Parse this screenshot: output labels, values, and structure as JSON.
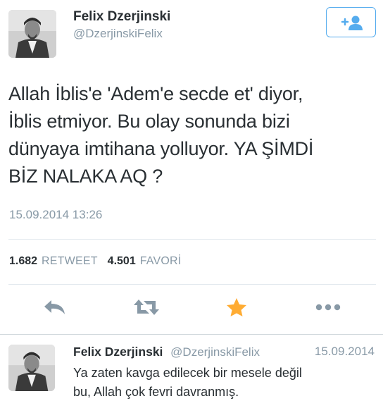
{
  "tweet": {
    "name": "Felix Dzerjinski",
    "handle": "@DzerjinskiFelix",
    "text_lines": [
      "Allah İblis'e 'Adem'e secde et' diyor,",
      "İblis etmiyor. Bu olay sonunda bizi",
      "dünyaya imtihana yolluyor. YA ŞİMDİ",
      "BİZ NALAKA AQ ?"
    ],
    "timestamp": "15.09.2014 13:26",
    "retweet_count": "1.682",
    "retweet_label": "RETWEET",
    "favorite_count": "4.501",
    "favorite_label": "FAVORİ"
  },
  "actions": {
    "reply_icon": "reply-arrow-icon",
    "retweet_icon": "retweet-icon",
    "favorite_icon": "star-icon",
    "more_icon": "more-dots-icon"
  },
  "follow_button": {
    "icon": "add-user-icon"
  },
  "reply": {
    "name": "Felix Dzerjinski",
    "handle": "@DzerjinskiFelix",
    "date": "15.09.2014",
    "text_lines": [
      "Ya zaten kavga edilecek bir mesele değil",
      "bu, Allah çok fevri davranmış."
    ]
  },
  "colors": {
    "accent": "#55acee",
    "action_icon": "#8899a6",
    "star": "#ffac33",
    "text": "#292f33",
    "muted": "#8899a6"
  }
}
